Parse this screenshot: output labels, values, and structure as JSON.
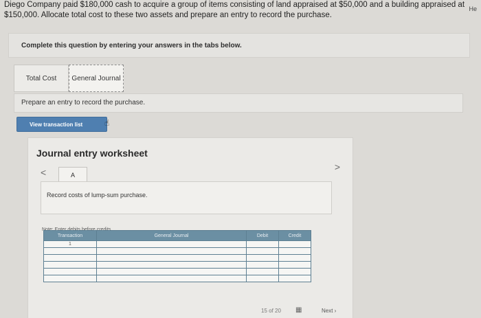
{
  "header": {
    "help_label": "He",
    "question": "Diego Company paid $180,000 cash to acquire a group of items consisting of land appraised at $50,000 and a building appraised at $150,000. Allocate total cost to these two assets and prepare an entry to record the purchase."
  },
  "instructions": "Complete this question by entering your answers in the tabs below.",
  "tabs": {
    "total_cost": "Total Cost",
    "general_journal": "General Journal"
  },
  "prompt": "Prepare an entry to record the purchase.",
  "view_button": "View transaction list",
  "worksheet": {
    "title": "Journal entry worksheet",
    "nav_prev": "<",
    "nav_next": ">",
    "entry_tab": "A",
    "entry_description": "Record costs of lump-sum purchase.",
    "note": "Note: Enter debits before credits.",
    "columns": {
      "transaction": "Transaction",
      "account": "General Journal",
      "debit": "Debit",
      "credit": "Credit"
    },
    "first_transaction": "1"
  },
  "footer": {
    "page_indicator": "15 of 20",
    "next_label": "Next"
  }
}
